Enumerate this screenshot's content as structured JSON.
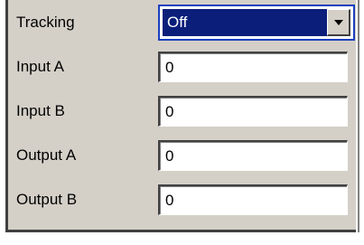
{
  "fields": {
    "tracking": {
      "label": "Tracking",
      "value": "Off",
      "icon": "chevron-down-icon"
    },
    "input_a": {
      "label": "Input A",
      "value": "0"
    },
    "input_b": {
      "label": "Input B",
      "value": "0"
    },
    "output_a": {
      "label": "Output A",
      "value": "0"
    },
    "output_b": {
      "label": "Output B",
      "value": "0"
    }
  },
  "colors": {
    "panel_bg": "#d4d0c8",
    "selection_bg": "#0a1e7a",
    "focus_border": "#1a3fbf",
    "field_bg": "#ffffff"
  }
}
